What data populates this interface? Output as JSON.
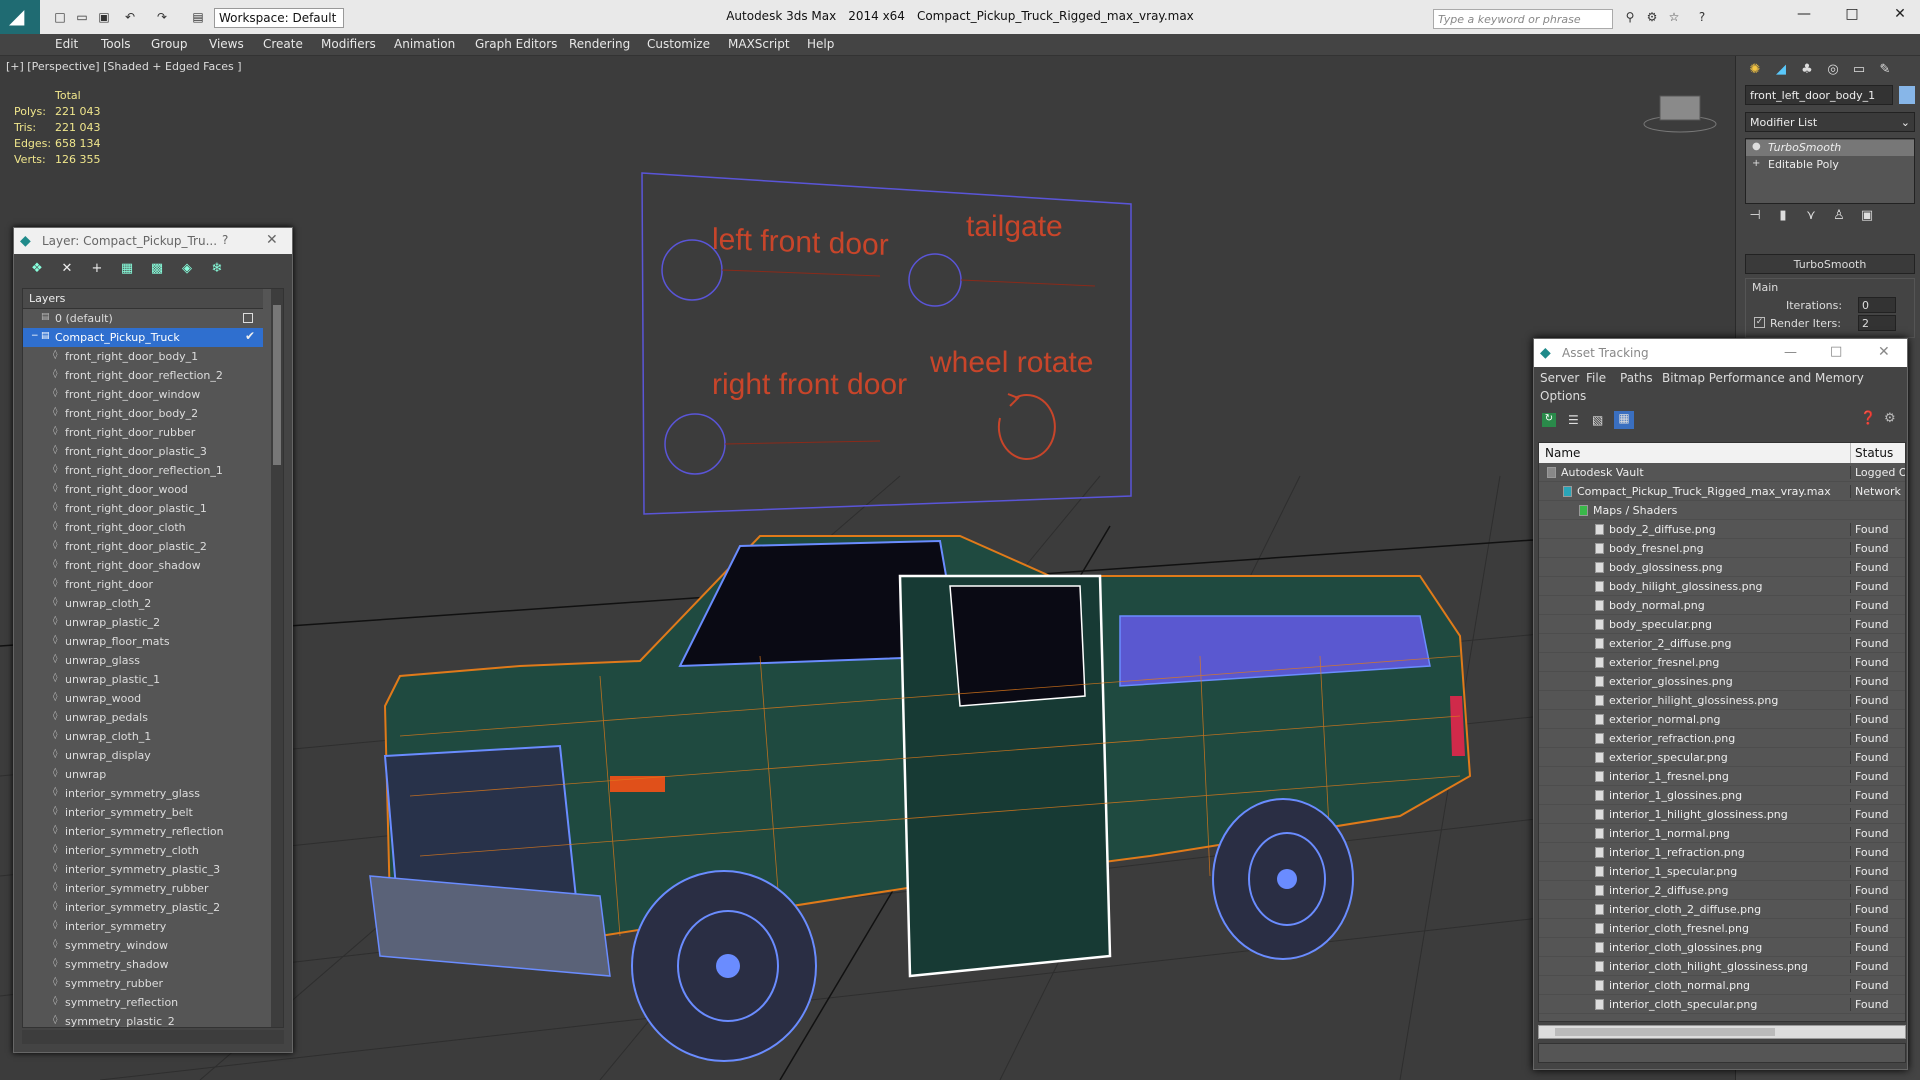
{
  "app": {
    "name": "Autodesk 3ds Max",
    "version": "2014 x64",
    "file": "Compact_Pickup_Truck_Rigged_max_vray.max",
    "workspace": "Workspace: Default",
    "search_placeholder": "Type a keyword or phrase"
  },
  "menu": [
    "Edit",
    "Tools",
    "Group",
    "Views",
    "Create",
    "Modifiers",
    "Animation",
    "Graph Editors",
    "Rendering",
    "Customize",
    "MAXScript",
    "Help"
  ],
  "viewport": {
    "label": "[+] [Perspective] [Shaded + Edged Faces ]",
    "stats": {
      "header": "Total",
      "rows": [
        {
          "label": "Polys:",
          "value": "221 043"
        },
        {
          "label": "Tris:",
          "value": "221 043"
        },
        {
          "label": "Edges:",
          "value": "658 134"
        },
        {
          "label": "Verts:",
          "value": "126 355"
        }
      ]
    },
    "rig_labels": {
      "left_front_door": "left front door",
      "tailgate": "tailgate",
      "right_front_door": "right front door",
      "wheel_rotate": "wheel rotate"
    }
  },
  "layer_dialog": {
    "title": "Layer: Compact_Pickup_Tru...",
    "help": "?",
    "column_header": "Layers",
    "default_layer": "0 (default)",
    "selected_layer": "Compact_Pickup_Truck",
    "children": [
      "front_right_door_body_1",
      "front_right_door_reflection_2",
      "front_right_door_window",
      "front_right_door_body_2",
      "front_right_door_rubber",
      "front_right_door_plastic_3",
      "front_right_door_reflection_1",
      "front_right_door_wood",
      "front_right_door_plastic_1",
      "front_right_door_cloth",
      "front_right_door_plastic_2",
      "front_right_door_shadow",
      "front_right_door",
      "unwrap_cloth_2",
      "unwrap_plastic_2",
      "unwrap_floor_mats",
      "unwrap_glass",
      "unwrap_plastic_1",
      "unwrap_wood",
      "unwrap_pedals",
      "unwrap_cloth_1",
      "unwrap_display",
      "unwrap",
      "interior_symmetry_glass",
      "interior_symmetry_belt",
      "interior_symmetry_reflection",
      "interior_symmetry_cloth",
      "interior_symmetry_plastic_3",
      "interior_symmetry_rubber",
      "interior_symmetry_plastic_2",
      "interior_symmetry",
      "symmetry_window",
      "symmetry_shadow",
      "symmetry_rubber",
      "symmetry_reflection",
      "symmetry_plastic_2"
    ]
  },
  "command_panel": {
    "object_name": "front_left_door_body_1",
    "modifier_list": "Modifier List",
    "stack": [
      "TurboSmooth",
      "Editable Poly"
    ],
    "rollout_title": "TurboSmooth",
    "group_main": "Main",
    "iterations_label": "Iterations:",
    "iterations_value": "0",
    "render_iters_label": "Render Iters:",
    "render_iters_value": "2"
  },
  "asset_tracking": {
    "title": "Asset Tracking",
    "menu": [
      "Server",
      "File",
      "Paths",
      "Bitmap Performance and Memory",
      "Options"
    ],
    "columns": {
      "name": "Name",
      "status": "Status"
    },
    "rows": [
      {
        "name": "Autodesk Vault",
        "status": "Logged Ou",
        "level": 1
      },
      {
        "name": "Compact_Pickup_Truck_Rigged_max_vray.max",
        "status": "Network P",
        "level": 2
      },
      {
        "name": "Maps / Shaders",
        "status": "",
        "level": 3
      },
      {
        "name": "body_2_diffuse.png",
        "status": "Found",
        "level": 4
      },
      {
        "name": "body_fresnel.png",
        "status": "Found",
        "level": 4
      },
      {
        "name": "body_glossiness.png",
        "status": "Found",
        "level": 4
      },
      {
        "name": "body_hilight_glossiness.png",
        "status": "Found",
        "level": 4
      },
      {
        "name": "body_normal.png",
        "status": "Found",
        "level": 4
      },
      {
        "name": "body_specular.png",
        "status": "Found",
        "level": 4
      },
      {
        "name": "exterior_2_diffuse.png",
        "status": "Found",
        "level": 4
      },
      {
        "name": "exterior_fresnel.png",
        "status": "Found",
        "level": 4
      },
      {
        "name": "exterior_glossines.png",
        "status": "Found",
        "level": 4
      },
      {
        "name": "exterior_hilight_glossiness.png",
        "status": "Found",
        "level": 4
      },
      {
        "name": "exterior_normal.png",
        "status": "Found",
        "level": 4
      },
      {
        "name": "exterior_refraction.png",
        "status": "Found",
        "level": 4
      },
      {
        "name": "exterior_specular.png",
        "status": "Found",
        "level": 4
      },
      {
        "name": "interior_1_fresnel.png",
        "status": "Found",
        "level": 4
      },
      {
        "name": "interior_1_glossines.png",
        "status": "Found",
        "level": 4
      },
      {
        "name": "interior_1_hilight_glossiness.png",
        "status": "Found",
        "level": 4
      },
      {
        "name": "interior_1_normal.png",
        "status": "Found",
        "level": 4
      },
      {
        "name": "interior_1_refraction.png",
        "status": "Found",
        "level": 4
      },
      {
        "name": "interior_1_specular.png",
        "status": "Found",
        "level": 4
      },
      {
        "name": "interior_2_diffuse.png",
        "status": "Found",
        "level": 4
      },
      {
        "name": "interior_cloth_2_diffuse.png",
        "status": "Found",
        "level": 4
      },
      {
        "name": "interior_cloth_fresnel.png",
        "status": "Found",
        "level": 4
      },
      {
        "name": "interior_cloth_glossines.png",
        "status": "Found",
        "level": 4
      },
      {
        "name": "interior_cloth_hilight_glossiness.png",
        "status": "Found",
        "level": 4
      },
      {
        "name": "interior_cloth_normal.png",
        "status": "Found",
        "level": 4
      },
      {
        "name": "interior_cloth_specular.png",
        "status": "Found",
        "level": 4
      }
    ]
  },
  "colors": {
    "stats_text": "#f0e68c",
    "selection": "#2f6fcf",
    "rig_text": "#c8452a",
    "wire_orange": "#e07a1a",
    "wire_blue": "#6a8cff",
    "truck_body": "#1f4a40"
  }
}
